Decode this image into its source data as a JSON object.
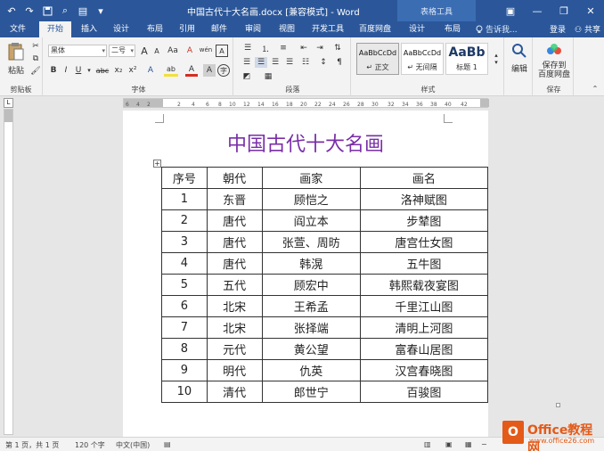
{
  "window": {
    "title": "中国古代十大名画.docx [兼容模式] - Word",
    "context_group": "表格工具",
    "controls": {
      "minimize": "—",
      "restore": "❐",
      "close": "✕",
      "ribbon_options": "▣"
    }
  },
  "qat": {
    "undo": "↶",
    "redo": "↷",
    "save": "💾",
    "print_preview": "⌕",
    "doc": "▤",
    "more": "▾"
  },
  "tabs": [
    "文件",
    "开始",
    "插入",
    "设计",
    "布局",
    "引用",
    "邮件",
    "审阅",
    "视图",
    "开发工具",
    "百度网盘",
    "设计",
    "布局"
  ],
  "active_tab": "开始",
  "tell_me": "告诉我...",
  "login": "登录",
  "share": "共享",
  "ribbon": {
    "clipboard": {
      "paste": "粘贴",
      "label": "剪贴板"
    },
    "font": {
      "name": "黑体",
      "size": "二号",
      "grow": "A",
      "shrink": "A",
      "aa": "Aa",
      "clear": "A",
      "wen": "wén",
      "bold": "B",
      "italic": "I",
      "underline": "U",
      "strike": "abc",
      "sub": "x₂",
      "sup": "x²",
      "effect": "A",
      "highlight": "ab",
      "color": "A",
      "charshade": "A",
      "circle": "字",
      "label": "字体"
    },
    "paragraph": {
      "label": "段落"
    },
    "styles": {
      "items": [
        {
          "sample": "AaBbCcDd",
          "name": "↵ 正文"
        },
        {
          "sample": "AaBbCcDd",
          "name": "↵ 无间隔"
        },
        {
          "sample": "AaBb",
          "name": "标题 1"
        }
      ],
      "label": "样式"
    },
    "editing": {
      "label": "编辑"
    },
    "save": {
      "label": "保存到\n百度网盘",
      "group": "保存"
    }
  },
  "document": {
    "heading": "中国古代十大名画",
    "table": {
      "headers": [
        "序号",
        "朝代",
        "画家",
        "画名"
      ],
      "rows": [
        [
          "1",
          "东晋",
          "顾恺之",
          "洛神赋图"
        ],
        [
          "2",
          "唐代",
          "阎立本",
          "步辇图"
        ],
        [
          "3",
          "唐代",
          "张萱、周昉",
          "唐宫仕女图"
        ],
        [
          "4",
          "唐代",
          "韩滉",
          "五牛图"
        ],
        [
          "5",
          "五代",
          "顾宏中",
          "韩熙载夜宴图"
        ],
        [
          "6",
          "北宋",
          "王希孟",
          "千里江山图"
        ],
        [
          "7",
          "北宋",
          "张择端",
          "清明上河图"
        ],
        [
          "8",
          "元代",
          "黄公望",
          "富春山居图"
        ],
        [
          "9",
          "明代",
          "仇英",
          "汉宫春晓图"
        ],
        [
          "10",
          "清代",
          "郎世宁",
          "百骏图"
        ]
      ]
    }
  },
  "status": {
    "page": "第 1 页，共 1 页",
    "words": "120 个字",
    "lang": "中文(中国)"
  },
  "watermark": {
    "box": "O",
    "text": "Office教程网",
    "url": "www.office26.com"
  }
}
